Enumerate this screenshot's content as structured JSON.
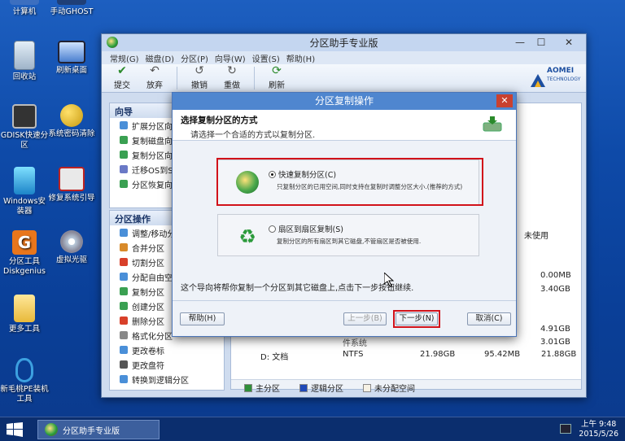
{
  "desktop_icons": [
    {
      "label": "计算机"
    },
    {
      "label": "手动GHOST"
    },
    {
      "label": "回收站"
    },
    {
      "label": "刷新桌面"
    },
    {
      "label": "GDISK快速分区"
    },
    {
      "label": "系统密码清除"
    },
    {
      "label": "Windows安装器"
    },
    {
      "label": "修复系统引导"
    },
    {
      "label": "分区工具Diskgenius"
    },
    {
      "label": "虚拟光驱"
    },
    {
      "label": "更多工具"
    },
    {
      "label": "新毛桃PE装机工具"
    }
  ],
  "app": {
    "title": "分区助手专业版",
    "menu": [
      "常规(G)",
      "磁盘(D)",
      "分区(P)",
      "向导(W)",
      "设置(S)",
      "帮助(H)"
    ],
    "toolbar": [
      "提交",
      "放弃",
      "撤销",
      "重做",
      "刷新"
    ],
    "logo_text": "AOMEI",
    "logo_sub": "TECHNOLOGY",
    "wizard_panel": {
      "title": "向导",
      "items": [
        "扩展分区向导",
        "复制磁盘向导",
        "复制分区向导",
        "迁移OS到SSD",
        "分区恢复向导"
      ]
    },
    "ops_panel": {
      "title": "分区操作",
      "items": [
        "调整/移动分区",
        "合并分区",
        "切割分区",
        "分配自由空间",
        "复制分区",
        "创建分区",
        "删除分区",
        "格式化分区",
        "更改卷标",
        "更改盘符",
        "转换到逻辑分区"
      ]
    },
    "table": {
      "header_unused": "未使用",
      "values_right": [
        "0.00MB",
        "3.40GB",
        "4.91GB",
        "3.01GB"
      ],
      "partial_row": "件系统",
      "row": {
        "name": "D: 文档",
        "fs": "NTFS",
        "capacity": "21.98GB",
        "used": "95.42MB",
        "free": "21.88GB"
      }
    },
    "legend": [
      "主分区",
      "逻辑分区",
      "未分配空间"
    ]
  },
  "dialog": {
    "title": "分区复制操作",
    "heading": "选择复制分区的方式",
    "subheading": "请选择一个合适的方式以复制分区.",
    "option1_label": "快速复制分区(C)",
    "option1_desc": "只复制分区的已用空间,同时支持在复制时调整分区大小.(推荐的方式)",
    "option2_label": "扇区到扇区复制(S)",
    "option2_desc": "复制分区的所有扇区到其它磁盘,不管扇区是否被使用.",
    "info": "这个导向将帮你复制一个分区到其它磁盘上,点击下一步按钮继续.",
    "help_button": "帮助(H)",
    "back_button": "上一步(B)",
    "next_button": "下一步(N)",
    "cancel_button": "取消(C)"
  },
  "taskbar": {
    "app": "分区助手专业版",
    "time": "上午 9:48",
    "date": "2015/5/26"
  },
  "colors": {
    "primary_partition": "#2f8f3a",
    "logical_partition": "#1f49b8",
    "unallocated": "#f6f1e4",
    "highlight": "#d1121a"
  }
}
